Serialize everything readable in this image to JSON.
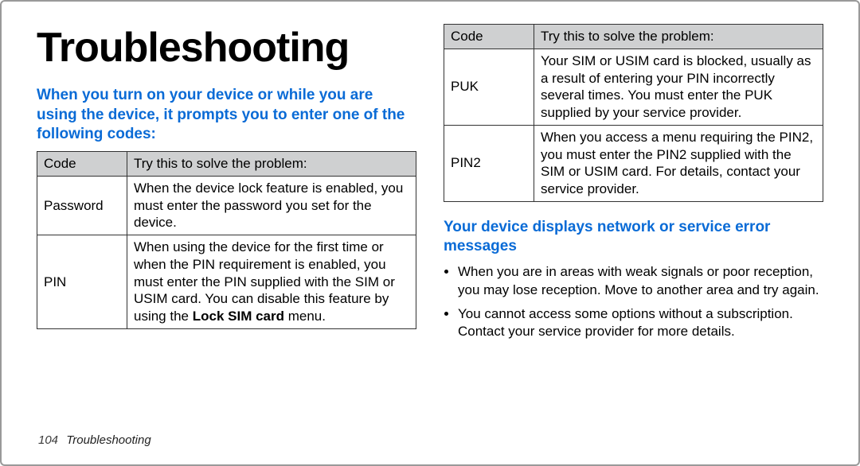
{
  "title": "Troubleshooting",
  "heading1": "When you turn on your device or while you are using the device, it prompts you to enter one of the following codes:",
  "table1": {
    "head": [
      "Code",
      "Try this to solve the problem:"
    ],
    "rows": [
      {
        "code": "Password",
        "desc": "When the device lock feature is enabled, you must enter the password you set for the device."
      },
      {
        "code": "PIN",
        "desc_prefix": "When using the device for the first time or when the PIN requirement is enabled, you must enter the PIN supplied with the SIM or USIM card. You can disable this feature by using the ",
        "desc_bold": "Lock SIM card",
        "desc_suffix": " menu."
      }
    ]
  },
  "table2": {
    "head": [
      "Code",
      "Try this to solve the problem:"
    ],
    "rows": [
      {
        "code": "PUK",
        "desc": "Your SIM or USIM card is blocked, usually as a result of entering your PIN incorrectly several times. You must enter the PUK supplied by your service provider."
      },
      {
        "code": "PIN2",
        "desc": "When you access a menu requiring the PIN2, you must enter the PIN2 supplied with the SIM or USIM card. For details, contact your service provider."
      }
    ]
  },
  "heading2": "Your device displays network or service error messages",
  "bullets": [
    "When you are in areas with weak signals or poor reception, you may lose reception. Move to another area and try again.",
    "You cannot access some options without a subscription. Contact your service provider for more details."
  ],
  "footer": {
    "page": "104",
    "section": "Troubleshooting"
  }
}
